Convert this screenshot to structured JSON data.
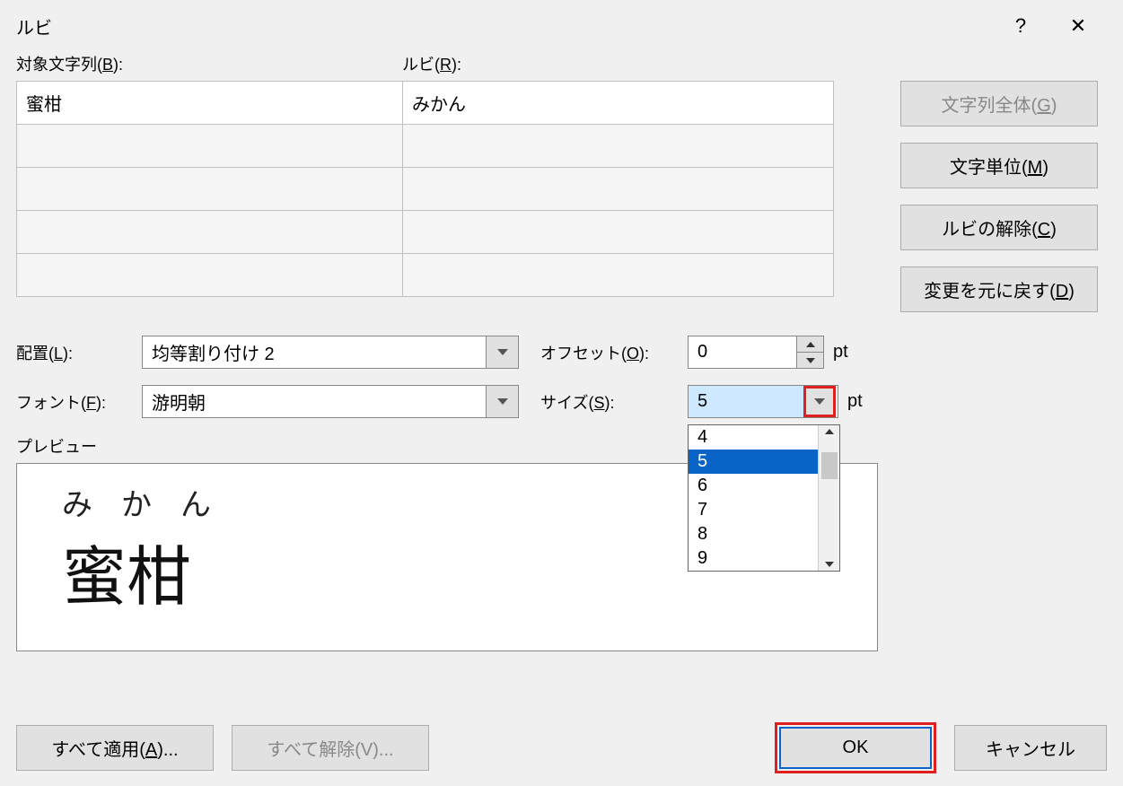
{
  "title": "ルビ",
  "labels": {
    "target": "対象文字列",
    "target_key": "B",
    "ruby": "ルビ",
    "ruby_key": "R",
    "align": "配置",
    "align_key": "L",
    "font": "フォント",
    "font_key": "F",
    "offset": "オフセット",
    "offset_key": "O",
    "size": "サイズ",
    "size_key": "S",
    "preview": "プレビュー",
    "pt": "pt"
  },
  "grid": {
    "rows": [
      {
        "target": "蜜柑",
        "ruby": "みかん"
      },
      {
        "target": "",
        "ruby": ""
      },
      {
        "target": "",
        "ruby": ""
      },
      {
        "target": "",
        "ruby": ""
      },
      {
        "target": "",
        "ruby": ""
      }
    ]
  },
  "side_buttons": {
    "whole": "文字列全体",
    "whole_key": "G",
    "unit": "文字単位",
    "unit_key": "M",
    "clear": "ルビの解除",
    "clear_key": "C",
    "revert": "変更を元に戻す",
    "revert_key": "D"
  },
  "values": {
    "align": "均等割り付け 2",
    "font": "游明朝",
    "offset": "0",
    "size": "5"
  },
  "size_options": [
    "4",
    "5",
    "6",
    "7",
    "8",
    "9"
  ],
  "size_selected": "5",
  "preview": {
    "ruby": "みかん",
    "base": "蜜柑"
  },
  "bottom": {
    "apply_all": "すべて適用",
    "apply_all_key": "A",
    "remove_all": "すべて解除",
    "remove_all_key": "V",
    "ok": "OK",
    "cancel": "キャンセル"
  }
}
